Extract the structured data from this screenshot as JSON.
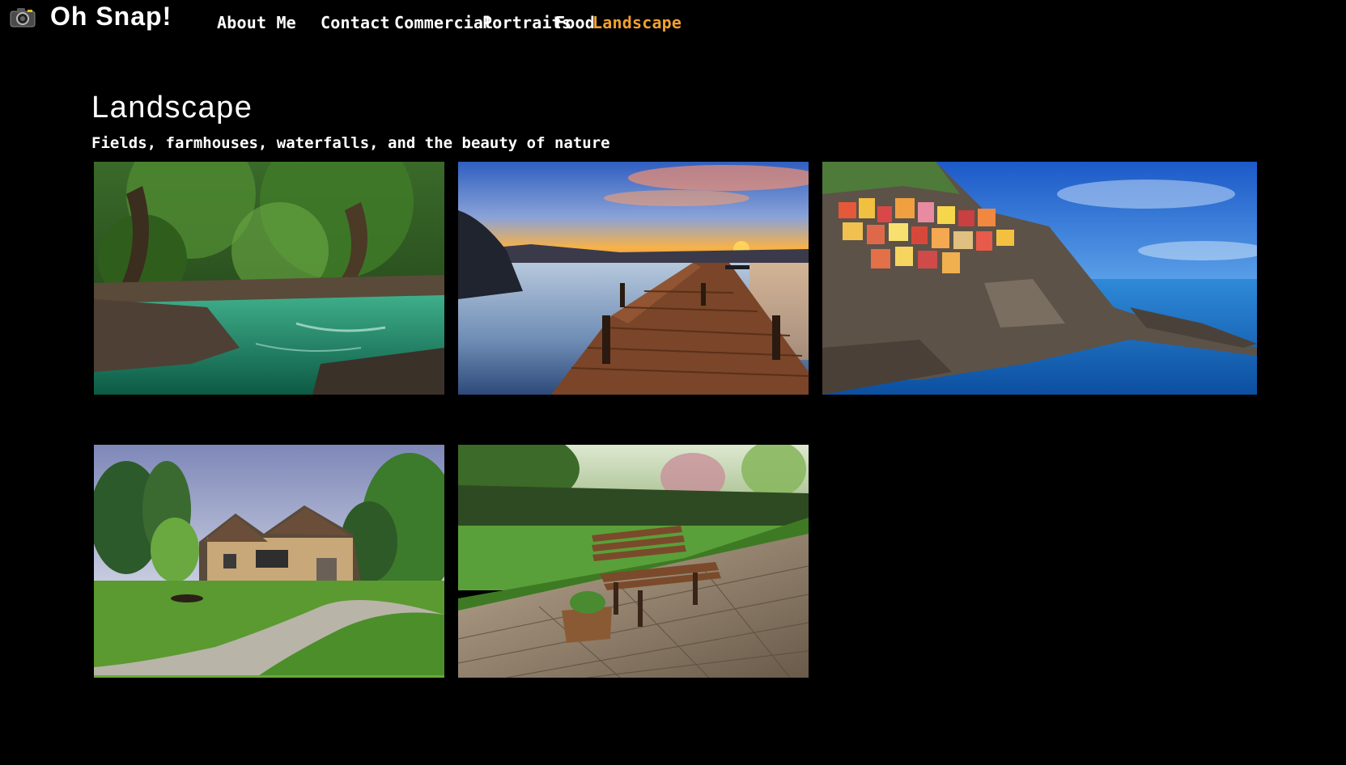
{
  "brand": {
    "name": "Oh Snap!",
    "icon": "camera-icon"
  },
  "nav": {
    "about": "About Me",
    "contact": "Contact",
    "commercial": "Commercial",
    "portraits": "Portraits",
    "food": "Food",
    "landscape": "Landscape",
    "active": "Landscape",
    "active_color": "#f0a030"
  },
  "page": {
    "title": "Landscape",
    "subtitle": "Fields, farmhouses, waterfalls, and the beauty of nature"
  },
  "gallery": [
    {
      "subject": "forest-river"
    },
    {
      "subject": "lake-pier-sunset"
    },
    {
      "subject": "cliffside-coastal-village"
    },
    {
      "subject": "country-house-driveway"
    },
    {
      "subject": "garden-bench"
    }
  ],
  "colors": {
    "background": "#000000",
    "text": "#ffffff",
    "accent": "#f0a030"
  }
}
